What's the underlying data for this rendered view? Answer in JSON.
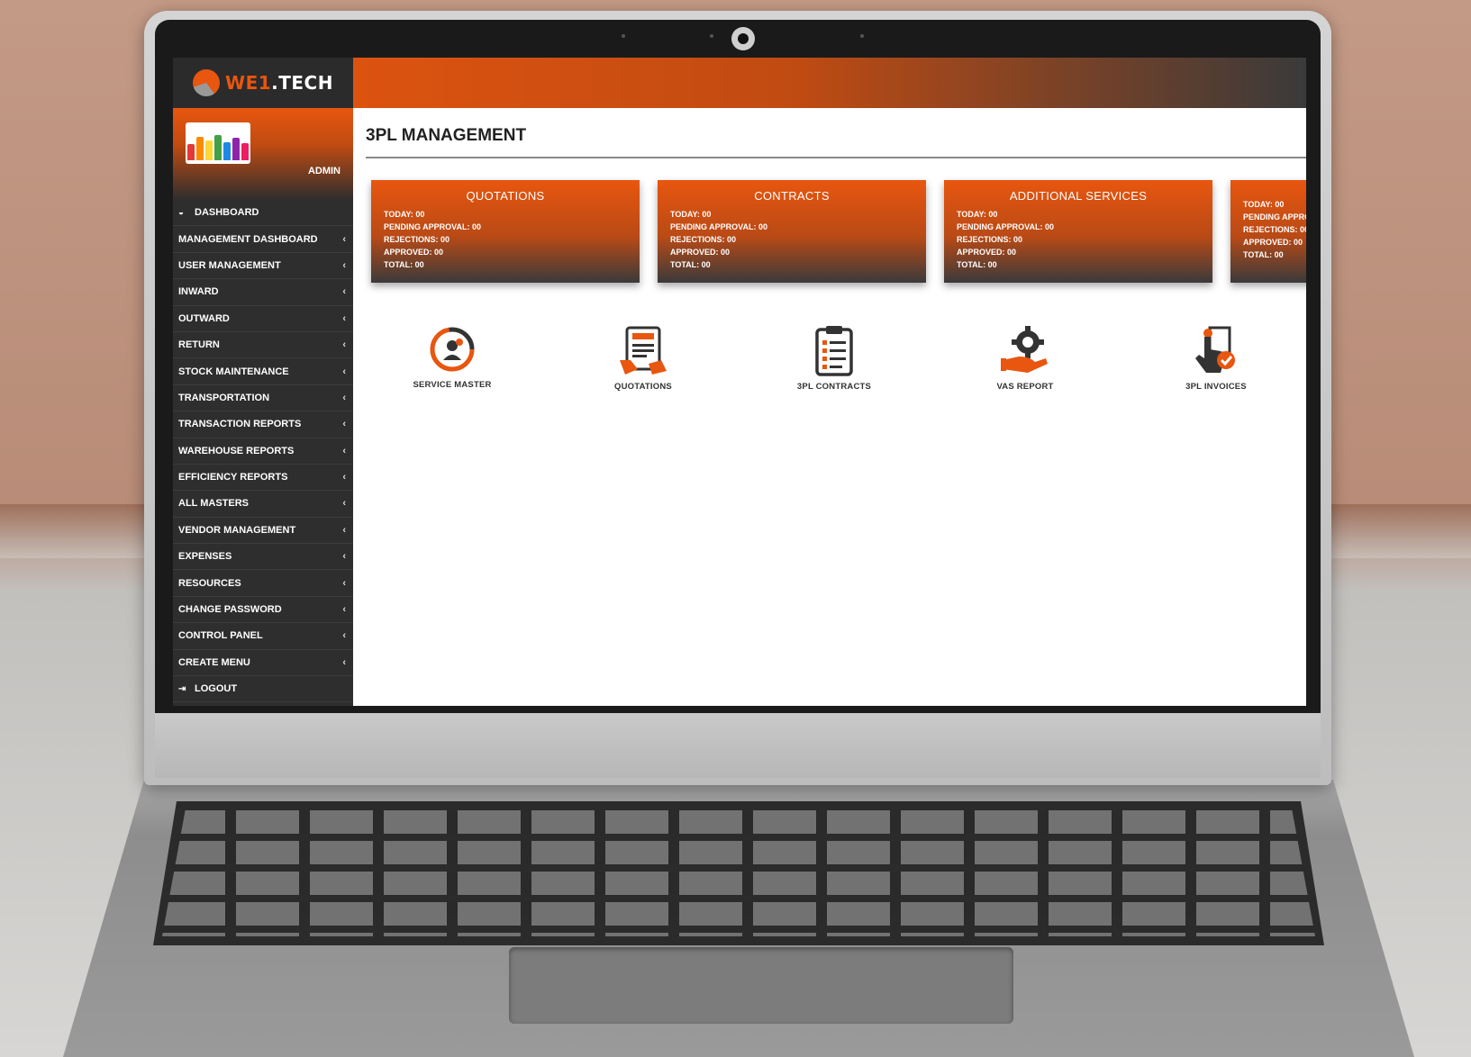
{
  "app": {
    "brand_prefix": "WE1",
    "brand_suffix": ".TECH",
    "role": "ADMIN",
    "accent_color": "#e8560f"
  },
  "sidebar": {
    "items": [
      {
        "label": "DASHBOARD",
        "icon": "dashboard-icon"
      },
      {
        "label": "MANAGEMENT DASHBOARD"
      },
      {
        "label": "USER MANAGEMENT"
      },
      {
        "label": "INWARD"
      },
      {
        "label": "OUTWARD"
      },
      {
        "label": "RETURN"
      },
      {
        "label": "STOCK MAINTENANCE"
      },
      {
        "label": "TRANSPORTATION"
      },
      {
        "label": "TRANSACTION REPORTS"
      },
      {
        "label": "WAREHOUSE REPORTS"
      },
      {
        "label": "EFFICIENCY REPORTS"
      },
      {
        "label": "ALL MASTERS"
      },
      {
        "label": "VENDOR MANAGEMENT"
      },
      {
        "label": "EXPENSES"
      },
      {
        "label": "RESOURCES"
      },
      {
        "label": "CHANGE PASSWORD"
      },
      {
        "label": "CONTROL PANEL"
      },
      {
        "label": "CREATE MENU"
      },
      {
        "label": "LOGOUT",
        "icon": "logout-icon"
      }
    ]
  },
  "main": {
    "title": "3PL MANAGEMENT",
    "cards": [
      {
        "title": "QUOTATIONS",
        "today": "TODAY: 00",
        "pending": "PENDING APPROVAL: 00",
        "rejections": "REJECTIONS: 00",
        "approved": "APPROVED: 00",
        "total": "TOTAL: 00"
      },
      {
        "title": "CONTRACTS",
        "today": "TODAY: 00",
        "pending": "PENDING APPROVAL: 00",
        "rejections": "REJECTIONS: 00",
        "approved": "APPROVED: 00",
        "total": "TOTAL: 00"
      },
      {
        "title": "ADDITIONAL SERVICES",
        "today": "TODAY: 00",
        "pending": "PENDING APPROVAL: 00",
        "rejections": "REJECTIONS: 00",
        "approved": "APPROVED: 00",
        "total": "TOTAL: 00"
      },
      {
        "title": "",
        "today": "TODAY: 00",
        "pending": "PENDING APPROV",
        "rejections": "REJECTIONS: 00",
        "approved": "APPROVED: 00",
        "total": "TOTAL: 00"
      }
    ],
    "tiles": [
      {
        "label": "SERVICE MASTER",
        "icon": "service-master-icon"
      },
      {
        "label": "QUOTATIONS",
        "icon": "quote-icon"
      },
      {
        "label": "3PL CONTRACTS",
        "icon": "clipboard-icon"
      },
      {
        "label": "VAS REPORT",
        "icon": "gear-hand-icon"
      },
      {
        "label": "3PL INVOICES",
        "icon": "invoice-tap-icon"
      }
    ]
  }
}
